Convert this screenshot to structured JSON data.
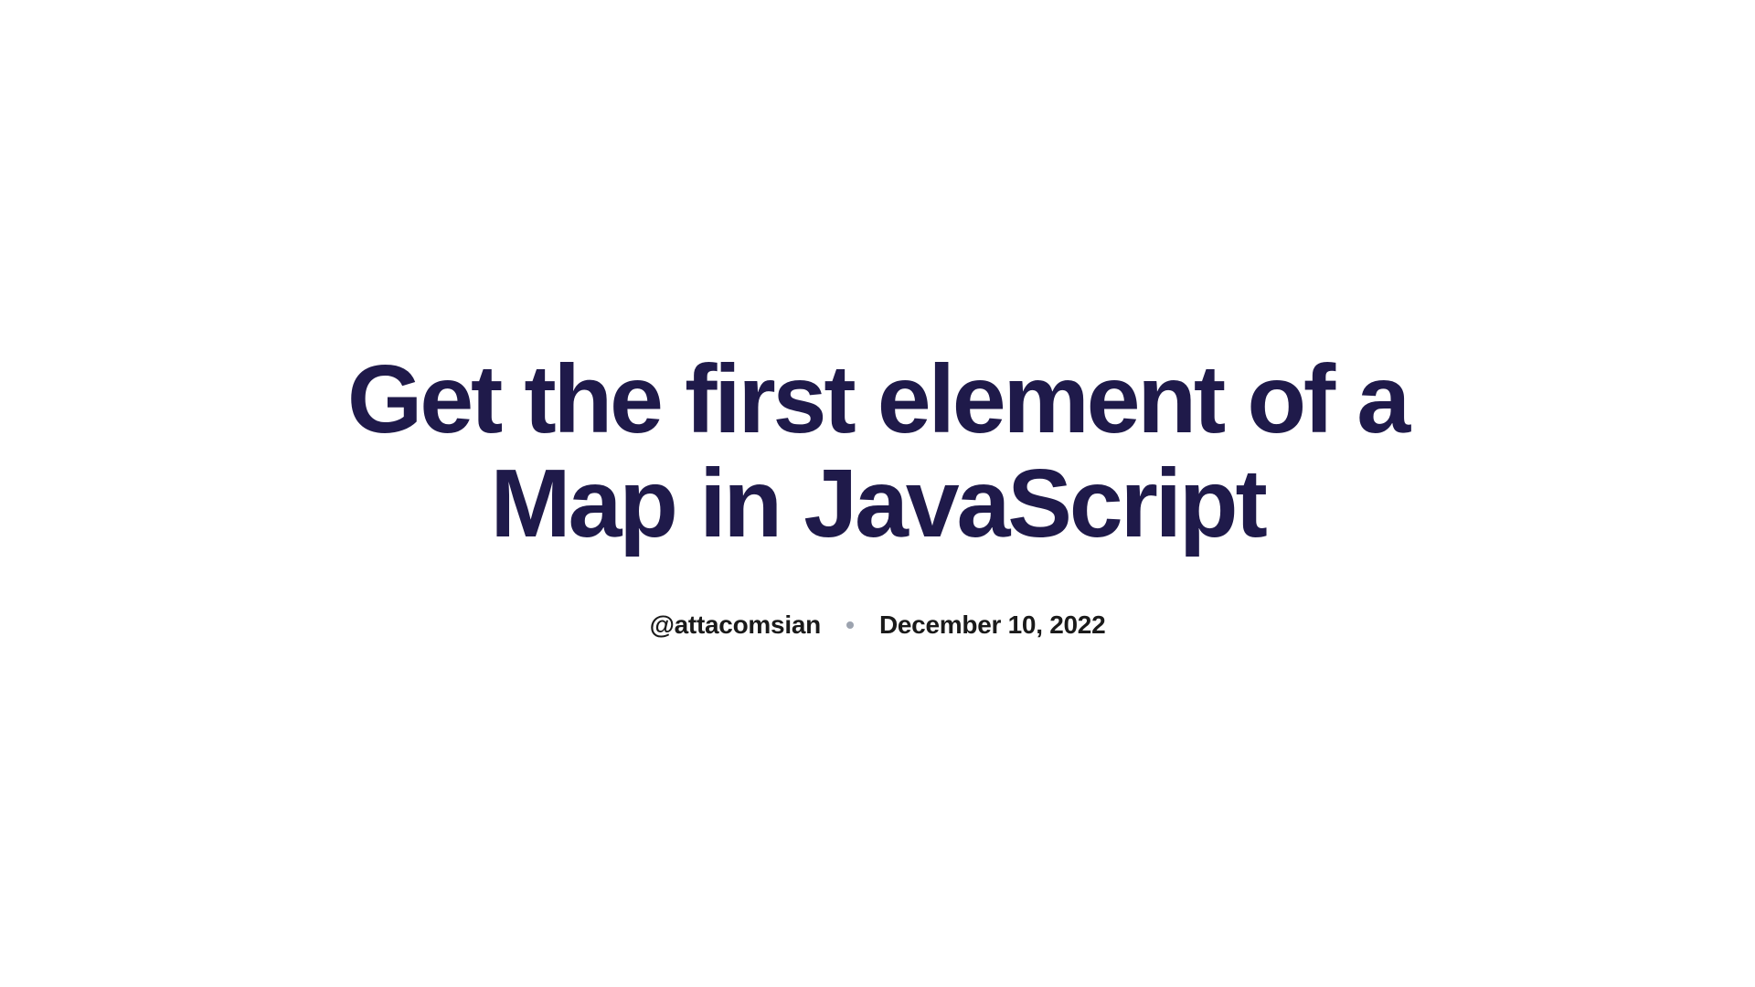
{
  "article": {
    "title": "Get the first element of a Map in JavaScript",
    "author": "@attacomsian",
    "date": "December 10, 2022"
  }
}
